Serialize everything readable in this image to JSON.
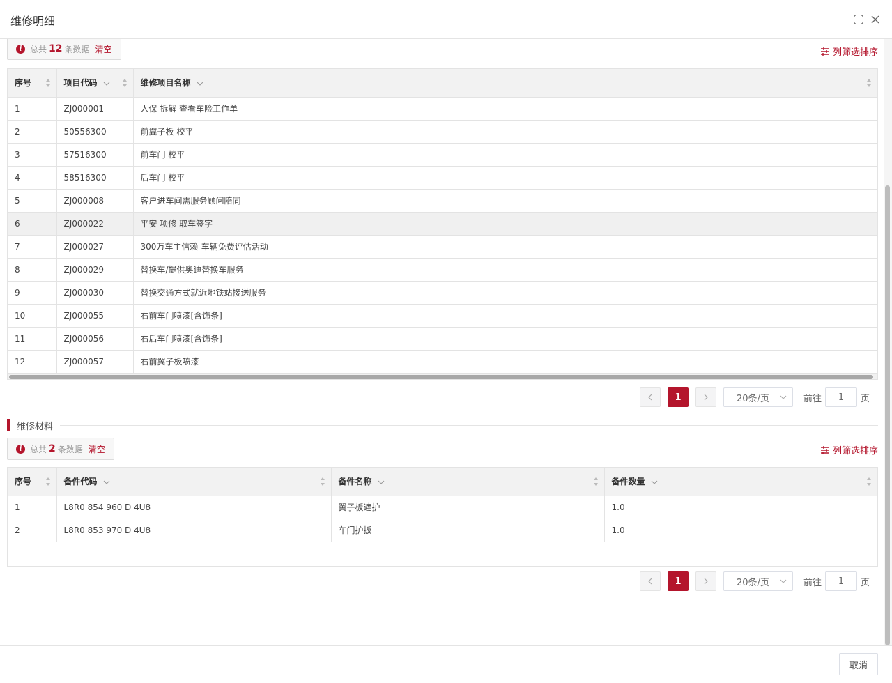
{
  "dialog": {
    "title": "维修明细",
    "icons": [
      "maximize-icon",
      "close-icon"
    ],
    "cancel_label": "取消"
  },
  "colors": {
    "accent": "#b4152c",
    "header_bg": "#f2f2f2",
    "highlight_row": "#f0f0f0"
  },
  "items_section": {
    "summary": {
      "prefix": "总共",
      "count": "12",
      "suffix": "条数据",
      "clear": "清空"
    },
    "column_filter_label": "列筛选排序",
    "columns": [
      "序号",
      "项目代码",
      "维修项目名称"
    ],
    "rows": [
      {
        "no": "1",
        "code": "ZJ000001",
        "name": "人保 拆解 查看车险工作单"
      },
      {
        "no": "2",
        "code": "50556300",
        "name": "前翼子板 校平"
      },
      {
        "no": "3",
        "code": "57516300",
        "name": "前车门 校平"
      },
      {
        "no": "4",
        "code": "58516300",
        "name": "后车门 校平"
      },
      {
        "no": "5",
        "code": "ZJ000008",
        "name": "客户进车间需服务顾问陪同"
      },
      {
        "no": "6",
        "code": "ZJ000022",
        "name": "平安 项修 取车签字"
      },
      {
        "no": "7",
        "code": "ZJ000027",
        "name": "300万车主信赖-车辆免费评估活动"
      },
      {
        "no": "8",
        "code": "ZJ000029",
        "name": "替换车/提供奥迪替换车服务"
      },
      {
        "no": "9",
        "code": "ZJ000030",
        "name": "替换交通方式就近地铁站接送服务"
      },
      {
        "no": "10",
        "code": "ZJ000055",
        "name": "右前车门喷漆[含饰条]"
      },
      {
        "no": "11",
        "code": "ZJ000056",
        "name": "右后车门喷漆[含饰条]"
      },
      {
        "no": "12",
        "code": "ZJ000057",
        "name": "右前翼子板喷漆"
      }
    ],
    "pagination": {
      "current_page": "1",
      "page_size": "20条/页",
      "goto_label": "前往",
      "goto_value": "1",
      "page_unit": "页"
    }
  },
  "materials_section": {
    "title": "维修材料",
    "summary": {
      "prefix": "总共",
      "count": "2",
      "suffix": "条数据",
      "clear": "清空"
    },
    "column_filter_label": "列筛选排序",
    "columns": [
      "序号",
      "备件代码",
      "备件名称",
      "备件数量"
    ],
    "rows": [
      {
        "no": "1",
        "code": "L8R0 854 960 D 4U8",
        "name": "翼子板遮护",
        "qty": "1.0"
      },
      {
        "no": "2",
        "code": "L8R0 853 970 D 4U8",
        "name": "车门护扳",
        "qty": "1.0"
      }
    ],
    "pagination": {
      "current_page": "1",
      "page_size": "20条/页",
      "goto_label": "前往",
      "goto_value": "1",
      "page_unit": "页"
    }
  }
}
